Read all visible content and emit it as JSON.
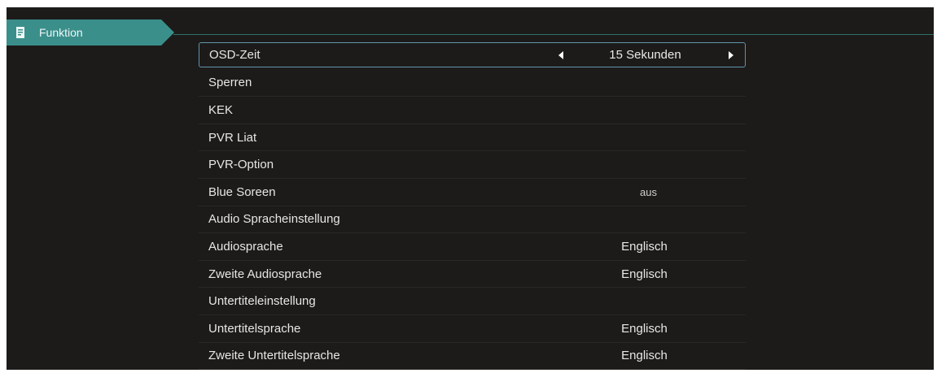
{
  "tab": {
    "label": "Funktion",
    "icon": "document-icon"
  },
  "menu": {
    "rows": [
      {
        "label": "OSD-Zeit",
        "value": "15 Sekunden"
      },
      {
        "label": "Sperren"
      },
      {
        "label": "KEK"
      },
      {
        "label": "PVR Liat"
      },
      {
        "label": "PVR-Option"
      },
      {
        "label": "Blue Soreen",
        "value": "aus"
      },
      {
        "label": "Audio Spracheinstellung"
      },
      {
        "label": "Audiosprache",
        "value": "Englisch"
      },
      {
        "label": "Zweite Audiosprache",
        "value": "Englisch"
      },
      {
        "label": "Untertiteleinstellung"
      },
      {
        "label": "Untertitelsprache",
        "value": "Englisch"
      },
      {
        "label": "Zweite Untertitelsprache",
        "value": "Englisch"
      }
    ]
  },
  "colors": {
    "background": "#1d1b19",
    "tab": "#3a8f8b",
    "selection_border": "#5f95ad"
  }
}
